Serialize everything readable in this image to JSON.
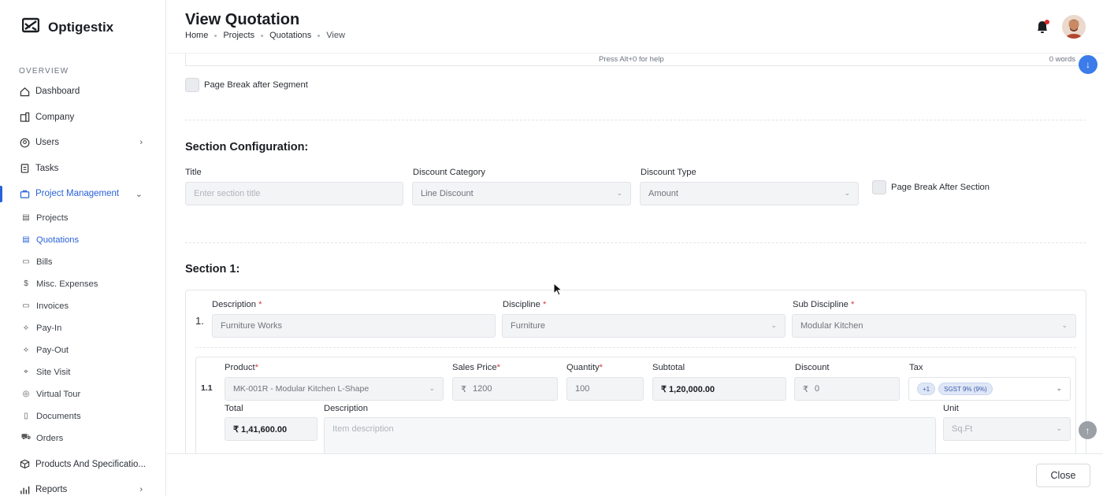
{
  "brand": {
    "name": "Optigestix"
  },
  "sidebar": {
    "section_label": "OVERVIEW",
    "items": [
      {
        "label": "Dashboard",
        "icon": "home-icon"
      },
      {
        "label": "Company",
        "icon": "building-icon"
      },
      {
        "label": "Users",
        "icon": "user-circle-icon"
      },
      {
        "label": "Tasks",
        "icon": "clipboard-icon"
      },
      {
        "label": "Project Management",
        "icon": "briefcase-icon"
      }
    ],
    "sub_items": [
      {
        "label": "Projects",
        "icon": "file-icon"
      },
      {
        "label": "Quotations",
        "icon": "file-text-icon"
      },
      {
        "label": "Bills",
        "icon": "receipt-icon"
      },
      {
        "label": "Misc. Expenses",
        "icon": "dollar-icon"
      },
      {
        "label": "Invoices",
        "icon": "invoice-icon"
      },
      {
        "label": "Pay-In",
        "icon": "pay-in-icon"
      },
      {
        "label": "Pay-Out",
        "icon": "pay-out-icon"
      },
      {
        "label": "Site Visit",
        "icon": "location-icon"
      },
      {
        "label": "Virtual Tour",
        "icon": "globe-icon"
      },
      {
        "label": "Documents",
        "icon": "document-icon"
      },
      {
        "label": "Orders",
        "icon": "cart-icon"
      }
    ],
    "bottom_items": [
      {
        "label": "Products And Specificatio...",
        "icon": "box-icon"
      },
      {
        "label": "Reports",
        "icon": "bar-chart-icon"
      }
    ]
  },
  "header": {
    "title": "View Quotation",
    "breadcrumbs": [
      "Home",
      "Projects",
      "Quotations",
      "View"
    ]
  },
  "editor": {
    "help_text": "Press Alt+0 for help",
    "word_count": "0 words"
  },
  "segment": {
    "page_break_label": "Page Break after Segment"
  },
  "section_config": {
    "heading": "Section Configuration:",
    "title_label": "Title",
    "title_placeholder": "Enter section title",
    "discount_category_label": "Discount Category",
    "discount_category_value": "Line Discount",
    "discount_type_label": "Discount Type",
    "discount_type_value": "Amount",
    "page_break_label": "Page Break After Section"
  },
  "section1": {
    "heading": "Section 1:",
    "number": "1.",
    "description_label": "Description",
    "description_value": "Furniture Works",
    "discipline_label": "Discipline",
    "discipline_value": "Furniture",
    "sub_discipline_label": "Sub Discipline",
    "sub_discipline_value": "Modular Kitchen",
    "item": {
      "number": "1.1",
      "product_label": "Product",
      "product_value": "MK-001R - Modular Kitchen L-Shape",
      "sales_price_label": "Sales Price",
      "sales_price_value": "1200",
      "quantity_label": "Quantity",
      "quantity_value": "100",
      "subtotal_label": "Subtotal",
      "subtotal_value": "₹ 1,20,000.00",
      "discount_label": "Discount",
      "discount_value": "0",
      "tax_label": "Tax",
      "tax_more": "+1",
      "tax_chip": "SGST 9% (9%)",
      "total_label": "Total",
      "total_value": "₹ 1,41,600.00",
      "desc_label": "Description",
      "desc_placeholder": "Item description",
      "unit_label": "Unit",
      "unit_value": "Sq.Ft"
    }
  },
  "currency_symbol": "₹",
  "required_mark": "*",
  "footer": {
    "close_label": "Close"
  },
  "colors": {
    "accent": "#2962d9",
    "required": "#d23b3b",
    "fab": "#3b7bea"
  }
}
